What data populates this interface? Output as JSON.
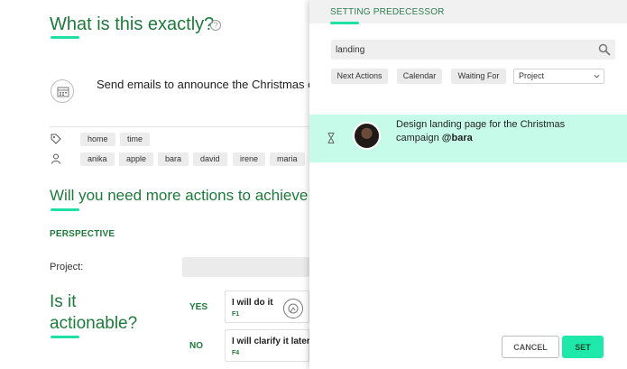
{
  "background_page": {
    "title": "What is this exactly?",
    "help_icon": "question-circle-icon",
    "task_text": "Send emails to announce the Christmas c",
    "tags": [
      "home",
      "time"
    ],
    "people": [
      "anika",
      "apple",
      "bara",
      "david",
      "irene",
      "maria"
    ],
    "more_actions_heading": "Will you need more actions to achieve t",
    "perspective_label": "PERSPECTIVE",
    "project_label": "Project:",
    "actionable_line1": "Is it",
    "actionable_line2": "actionable?",
    "yes_label": "YES",
    "no_label": "NO",
    "option_do": {
      "title": "I will do it",
      "key": "F1"
    },
    "option_clarify": {
      "title": "I will clarify it later",
      "key": "F4"
    }
  },
  "predecessor_panel": {
    "title": "SETTING PREDECESSOR",
    "search_value": "landing",
    "filters": [
      "Next Actions",
      "Calendar",
      "Waiting For"
    ],
    "project_select": "Project",
    "result": {
      "line1": "Design   landing   page for the Christmas",
      "line2_text": "campaign",
      "mention": "@bara"
    },
    "cancel_label": "CANCEL",
    "set_label": "SET"
  },
  "colors": {
    "accent": "#1fe0a4",
    "green_text": "#1e7a3b",
    "highlight_row": "#c6fbe9"
  }
}
